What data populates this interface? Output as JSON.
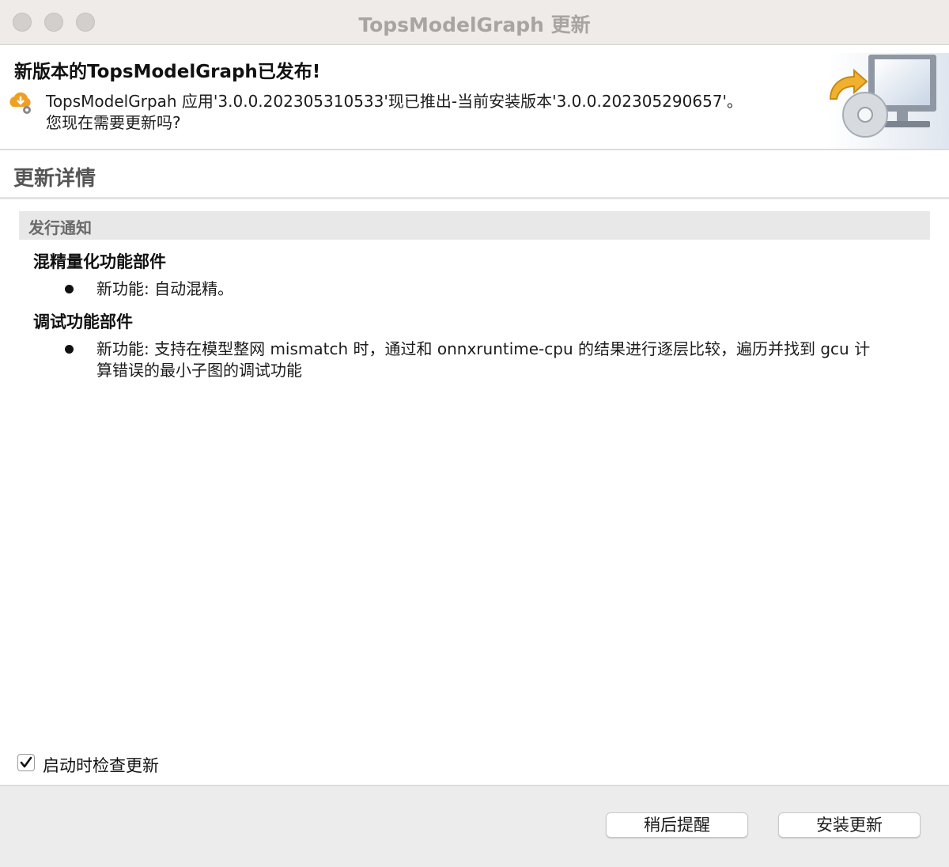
{
  "window": {
    "title": "TopsModelGraph 更新"
  },
  "banner": {
    "heading": "新版本的TopsModelGraph已发布!",
    "message_line1": "TopsModelGrpah 应用'3.0.0.202305310533'现已推出-当前安装版本'3.0.0.202305290657'。",
    "message_line2": "您现在需要更新吗?"
  },
  "details": {
    "section_title": "更新详情",
    "notes_header": "发行通知",
    "features": [
      {
        "title": "混精量化功能部件",
        "bullets": [
          "新功能: 自动混精。"
        ]
      },
      {
        "title": "调试功能部件",
        "bullets": [
          "新功能: 支持在模型整网 mismatch 时，通过和 onnxruntime-cpu 的结果进行逐层比较，遍历并找到 gcu 计算错误的最小子图的调试功能"
        ]
      }
    ]
  },
  "options": {
    "check_on_startup_label": "启动时检查更新",
    "check_on_startup": true
  },
  "buttons": {
    "remind_later": "稍后提醒",
    "install": "安装更新"
  },
  "colors": {
    "titlebar_bg": "#efebe8",
    "footer_bg": "#ececec",
    "notes_header_bg": "#e8e8e8",
    "update_icon": "#f0a020"
  },
  "icons": {
    "banner": "download-update-icon",
    "banner_art": "install-monitor-cd-icon",
    "check": "checkmark-icon"
  }
}
